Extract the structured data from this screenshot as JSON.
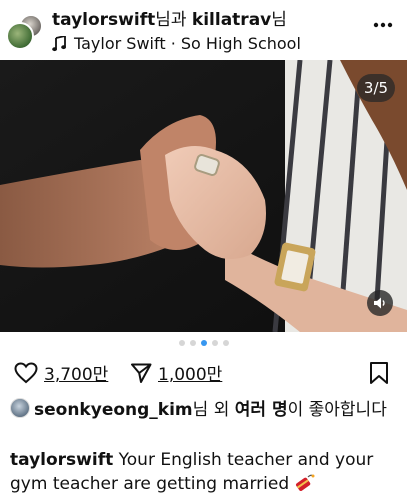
{
  "post": {
    "header": {
      "username": "taylorswift",
      "collab_connector": "님과",
      "collaborator": "killatrav",
      "collab_suffix": "님",
      "music": {
        "artist": "Taylor Swift",
        "separator": "·",
        "song": "So High School"
      }
    },
    "media": {
      "counter": "3/5",
      "current_index": 3,
      "total": 5
    },
    "actions": {
      "like_count": "3,700만",
      "share_count": "1,000만"
    },
    "likes": {
      "username": "seonkyeong_kim",
      "text_part1": "님 외 ",
      "others": "여러 명",
      "text_part2": "이 좋아합니다"
    },
    "caption": {
      "username": "taylorswift",
      "text": "Your English teacher and your gym teacher are getting married"
    }
  },
  "icons": {
    "avatar": "profile-avatar",
    "music": "music-note-icon",
    "more": "more-options-icon",
    "sound": "speaker-icon",
    "like": "heart-icon",
    "share": "send-icon",
    "save": "bookmark-icon",
    "emoji": "firecracker-emoji"
  },
  "colors": {
    "accent_dot": "#3797f0",
    "text": "#111111"
  }
}
